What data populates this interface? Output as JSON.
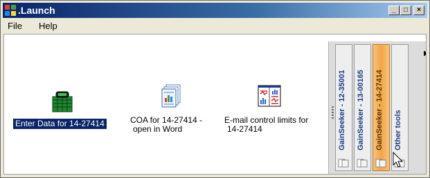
{
  "window": {
    "title": ".Launch"
  },
  "menu": {
    "items": [
      "File",
      "Help"
    ]
  },
  "launch_items": [
    {
      "label": "Enter Data for 14-27414",
      "icon": "data-entry-grid-icon",
      "selected": true
    },
    {
      "label_line1": "COA for 14-27414 -",
      "label_line2": "open in Word",
      "icon": "documents-stack-icon"
    },
    {
      "label_line1": "E-mail control limits for",
      "label_line2": "14-27414",
      "icon": "control-chart-icon"
    }
  ],
  "side_tabs": [
    {
      "label": "GainSeeker - 12-35001",
      "active": false
    },
    {
      "label": "GainSeeker - 13-00165",
      "active": false
    },
    {
      "label": "GainSeeker - 14-27414",
      "active": true
    },
    {
      "label": "Other tools",
      "active": false
    }
  ],
  "colors": {
    "selection": "#0a246a",
    "active_tab": "#f3a548",
    "titlebar": "#0a246a"
  }
}
